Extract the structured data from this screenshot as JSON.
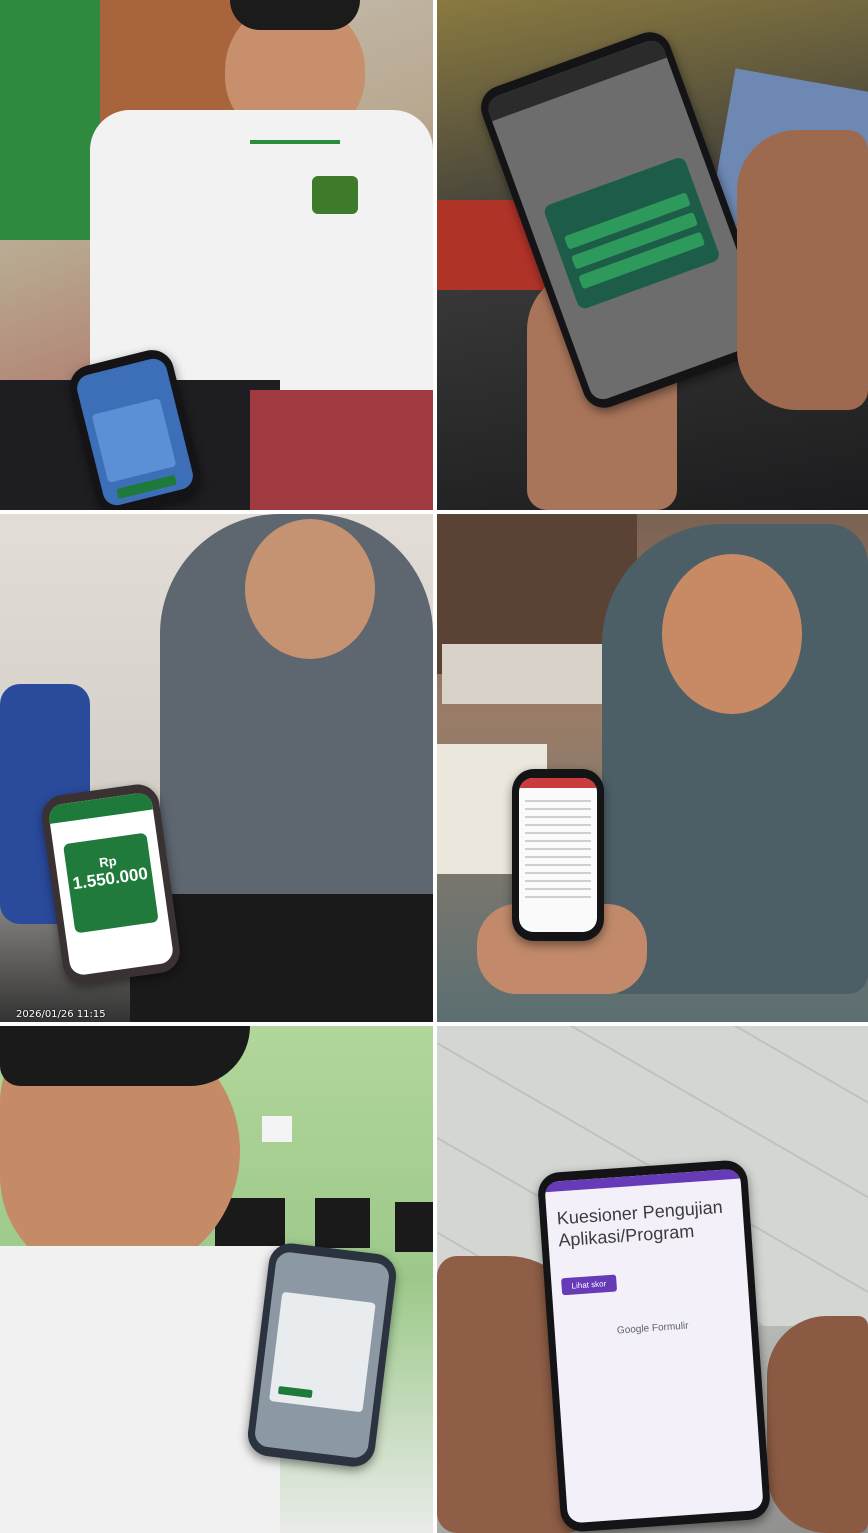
{
  "timestamp": "2026/01/26 11:15",
  "phone_screens": {
    "amount_currency": "Rp",
    "amount_value": "1.550.000",
    "form_title": "Kuesioner Pengujian Aplikasi/Program",
    "form_button": "Lihat skor",
    "form_brand": "Google Formulir"
  },
  "colors": {
    "app_green": "#1e7a3a",
    "form_purple": "#673ab7"
  }
}
